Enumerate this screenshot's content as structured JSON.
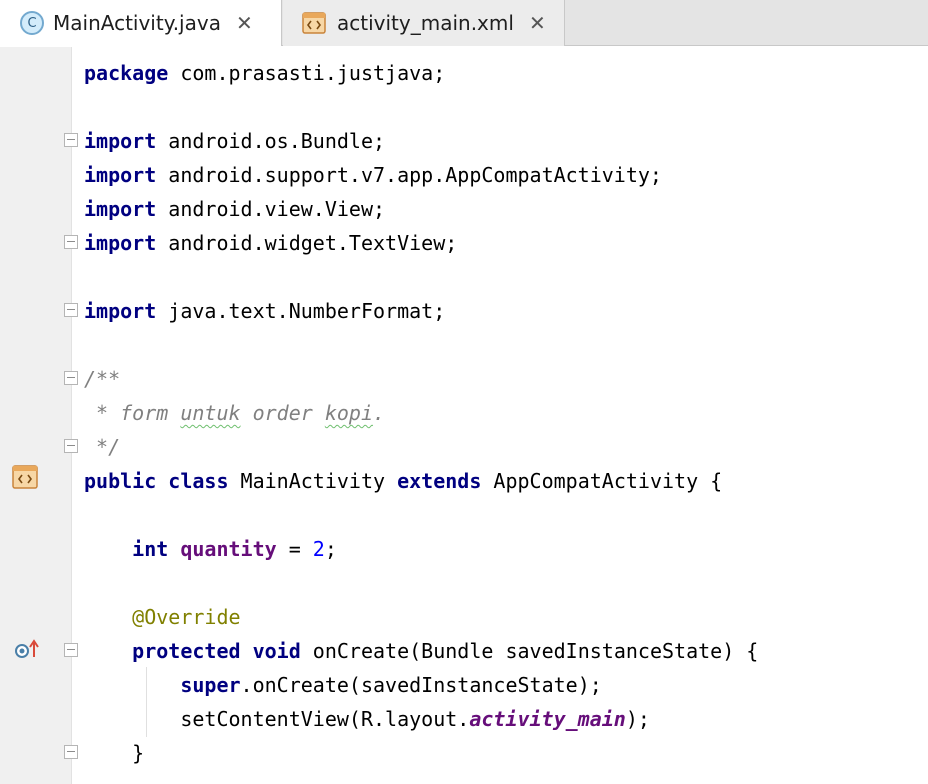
{
  "tabs": [
    {
      "label": "MainActivity.java",
      "icon": "java-class-icon",
      "icon_text": "C",
      "active": true,
      "close": "✕"
    },
    {
      "label": "activity_main.xml",
      "icon": "xml-layout-icon",
      "active": false,
      "close": "✕"
    }
  ],
  "code": {
    "package_kw": "package",
    "package_name": " com.prasasti.justjava;",
    "import_kw": "import",
    "imports": [
      " android.os.Bundle;",
      " android.support.v7.app.AppCompatActivity;",
      " android.view.View;",
      " android.widget.TextView;"
    ],
    "import_java": " java.text.NumberFormat;",
    "doc_open": "/**",
    "doc_prefix": " * form ",
    "doc_word1": "untuk",
    "doc_mid": " order ",
    "doc_word2": "kopi",
    "doc_end": ".",
    "doc_close": " */",
    "class_kw1": "public",
    "class_kw2": "class",
    "class_name": " MainActivity ",
    "class_kw3": "extends",
    "class_super": " AppCompatActivity {",
    "field_type": "int",
    "field_name": "quantity",
    "field_assign": " = ",
    "field_value": "2",
    "field_end": ";",
    "annotation": "@Override",
    "method_kw1": "protected",
    "method_kw2": "void",
    "method_sig": " onCreate(Bundle savedInstanceState) {",
    "super_kw": "super",
    "super_call": ".onCreate(savedInstanceState);",
    "set_content_pre": "setContentView(R.layout.",
    "set_content_field": "activity_main",
    "set_content_post": ");",
    "close_brace": "}"
  },
  "colors": {
    "keyword": "#000080",
    "comment": "#808080",
    "field": "#660e7a",
    "number": "#0000ff",
    "annotation": "#808000"
  }
}
